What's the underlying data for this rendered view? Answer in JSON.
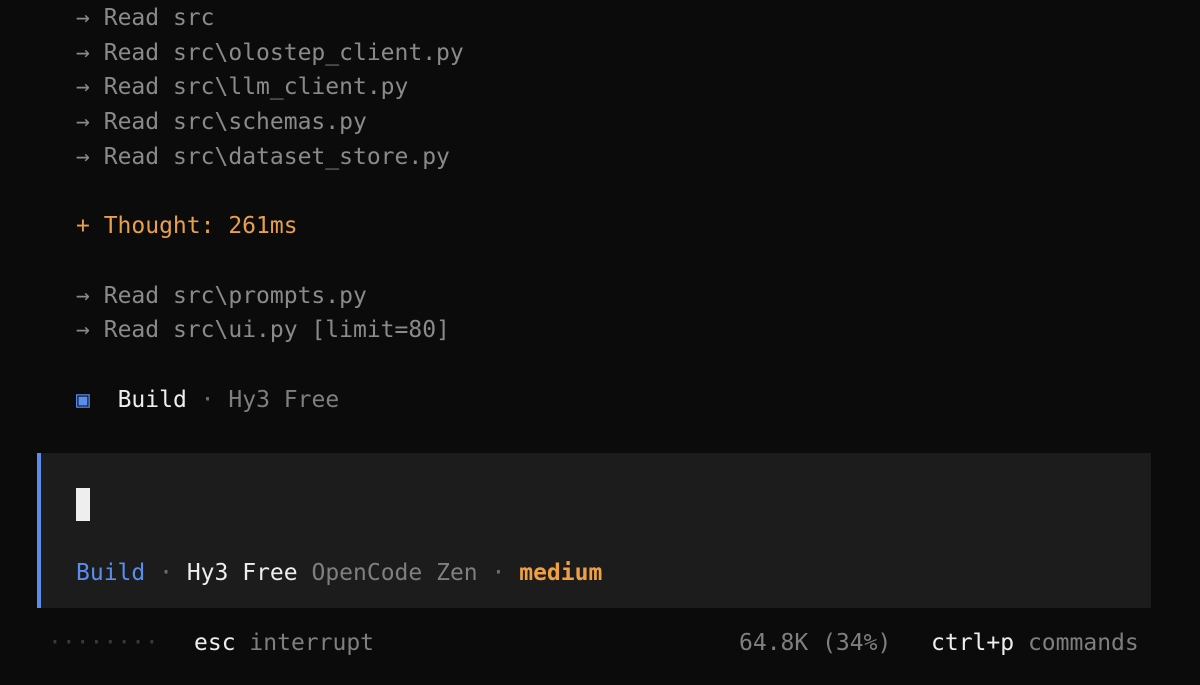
{
  "log": {
    "lines_top": [
      {
        "arrow": "→",
        "text": "Read src"
      },
      {
        "arrow": "→",
        "text": "Read src\\olostep_client.py"
      },
      {
        "arrow": "→",
        "text": "Read src\\llm_client.py"
      },
      {
        "arrow": "→",
        "text": "Read src\\schemas.py"
      },
      {
        "arrow": "→",
        "text": "Read src\\dataset_store.py"
      }
    ],
    "thought": "+ Thought: 261ms",
    "lines_bottom": [
      {
        "arrow": "→",
        "text": "Read src\\prompts.py"
      },
      {
        "arrow": "→",
        "text": "Read src\\ui.py [limit=80]"
      }
    ],
    "build_line": {
      "icon": "▣",
      "mode": "Build",
      "separator": "·",
      "model": "Hy3 Free"
    }
  },
  "input": {
    "status": {
      "mode": "Build",
      "separator1": "·",
      "model": "Hy3 Free",
      "provider": "OpenCode Zen",
      "separator2": "·",
      "effort": "medium"
    }
  },
  "footer": {
    "spinner": "········",
    "esc_key": "esc",
    "esc_label": "interrupt",
    "tokens": "64.8K (34%)",
    "cmd_key": "ctrl+p",
    "cmd_label": "commands"
  },
  "colors": {
    "background": "#0b0b0b",
    "panel": "#1c1c1c",
    "accent_blue": "#5b8def",
    "accent_orange": "#f0a040",
    "text_dim": "#8a8a8a",
    "text_bright": "#eeeeee"
  }
}
